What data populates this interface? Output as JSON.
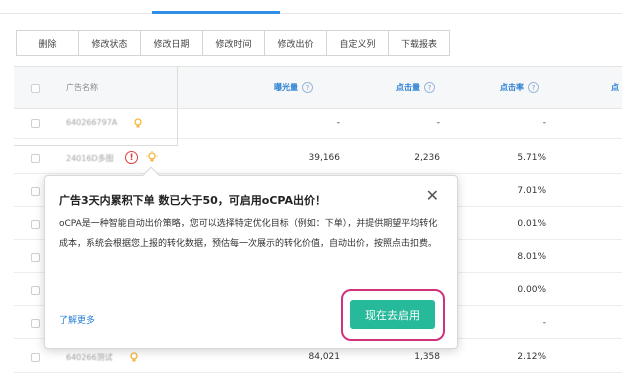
{
  "toolbar": {
    "buttons": [
      "删除",
      "修改状态",
      "修改日期",
      "修改时间",
      "修改出价",
      "自定义列",
      "下载报表"
    ]
  },
  "table": {
    "headers": {
      "name": "广告名称",
      "impressions": "曝光量",
      "clicks": "点击量",
      "ctr": "点击率",
      "partial": "点"
    },
    "help_glyph": "?",
    "rows": [
      {
        "name": "640266797A",
        "impressions": "-",
        "clicks": "-",
        "ctr": "-"
      },
      {
        "name": "24016D多图",
        "impressions": "39,166",
        "clicks": "2,236",
        "ctr": "5.71%"
      },
      {
        "name": "",
        "impressions": "",
        "clicks": "",
        "ctr": "7.01%"
      },
      {
        "name": "",
        "impressions": "",
        "clicks": "",
        "ctr": "0.01%"
      },
      {
        "name": "",
        "impressions": "",
        "clicks": "",
        "ctr": "8.01%"
      },
      {
        "name": "",
        "impressions": "",
        "clicks": "",
        "ctr": "0.00%"
      },
      {
        "name": "",
        "impressions": "",
        "clicks": "",
        "ctr": "-"
      },
      {
        "name": "640266测试",
        "impressions": "84,021",
        "clicks": "1,358",
        "ctr": "2.12%"
      }
    ]
  },
  "warning_glyph": "!",
  "popup": {
    "title": "广告3天内累积下单 数已大于50，可启用oCPA出价！",
    "close_glyph": "✕",
    "body": "oCPA是一种智能自动出价策略，您可以选择特定优化目标（例如：下单），并提供期望平均转化成本，系统会根据您上报的转化数据，预估每一次展示的转化价值，自动出价，按照点击扣费。",
    "learn_more": "了解更多",
    "cta": "现在去启用"
  },
  "colors": {
    "accent_blue": "#2a7fd4",
    "cta_green": "#26b99a",
    "highlight_ring": "#d0337d",
    "warning_red": "#e23c3c",
    "bulb_yellow": "#f4b73b"
  }
}
